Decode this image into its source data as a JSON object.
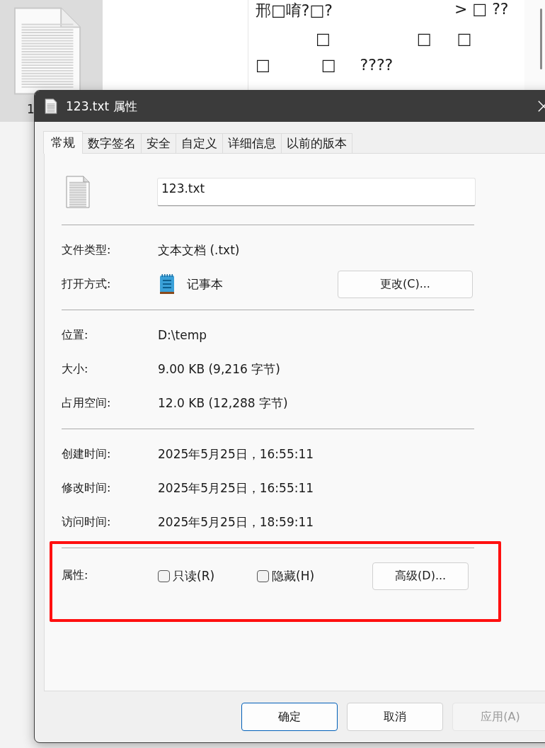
{
  "background": {
    "file_tile_label": "1",
    "editor_lines": [
      [
        "邢□唷?□?",
        "> □ ??"
      ],
      [
        "□",
        "□",
        "□"
      ],
      [
        "□",
        "□",
        "????"
      ]
    ]
  },
  "dialog": {
    "title": "123.txt 属性",
    "tabs": [
      {
        "label": "常规",
        "selected": true
      },
      {
        "label": "数字签名",
        "selected": false
      },
      {
        "label": "安全",
        "selected": false
      },
      {
        "label": "自定义",
        "selected": false
      },
      {
        "label": "详细信息",
        "selected": false
      },
      {
        "label": "以前的版本",
        "selected": false
      }
    ],
    "file_name": "123.txt",
    "sections": [
      [
        {
          "kind": "text",
          "label": "文件类型:",
          "value": "文本文档 (.txt)"
        },
        {
          "kind": "app",
          "label": "打开方式:",
          "value": "记事本",
          "button": "更改(C)..."
        }
      ],
      [
        {
          "kind": "text",
          "label": "位置:",
          "value": "D:\\temp"
        },
        {
          "kind": "text",
          "label": "大小:",
          "value": "9.00 KB (9,216 字节)"
        },
        {
          "kind": "text",
          "label": "占用空间:",
          "value": "12.0 KB (12,288 字节)"
        }
      ],
      [
        {
          "kind": "text",
          "label": "创建时间:",
          "value": "2025年5月25日，16:55:11"
        },
        {
          "kind": "text",
          "label": "修改时间:",
          "value": "2025年5月25日，16:55:11"
        },
        {
          "kind": "text",
          "label": "访问时间:",
          "value": "2025年5月25日，18:59:11"
        }
      ]
    ],
    "attributes": {
      "label": "属性:",
      "checkboxes": [
        {
          "label": "只读(R)",
          "checked": false
        },
        {
          "label": "隐藏(H)",
          "checked": false
        }
      ],
      "button": "高级(D)..."
    },
    "buttons": [
      {
        "label": "确定",
        "kind": "primary",
        "disabled": false
      },
      {
        "label": "取消",
        "kind": "normal",
        "disabled": false
      },
      {
        "label": "应用(A)",
        "kind": "normal",
        "disabled": true
      }
    ]
  }
}
